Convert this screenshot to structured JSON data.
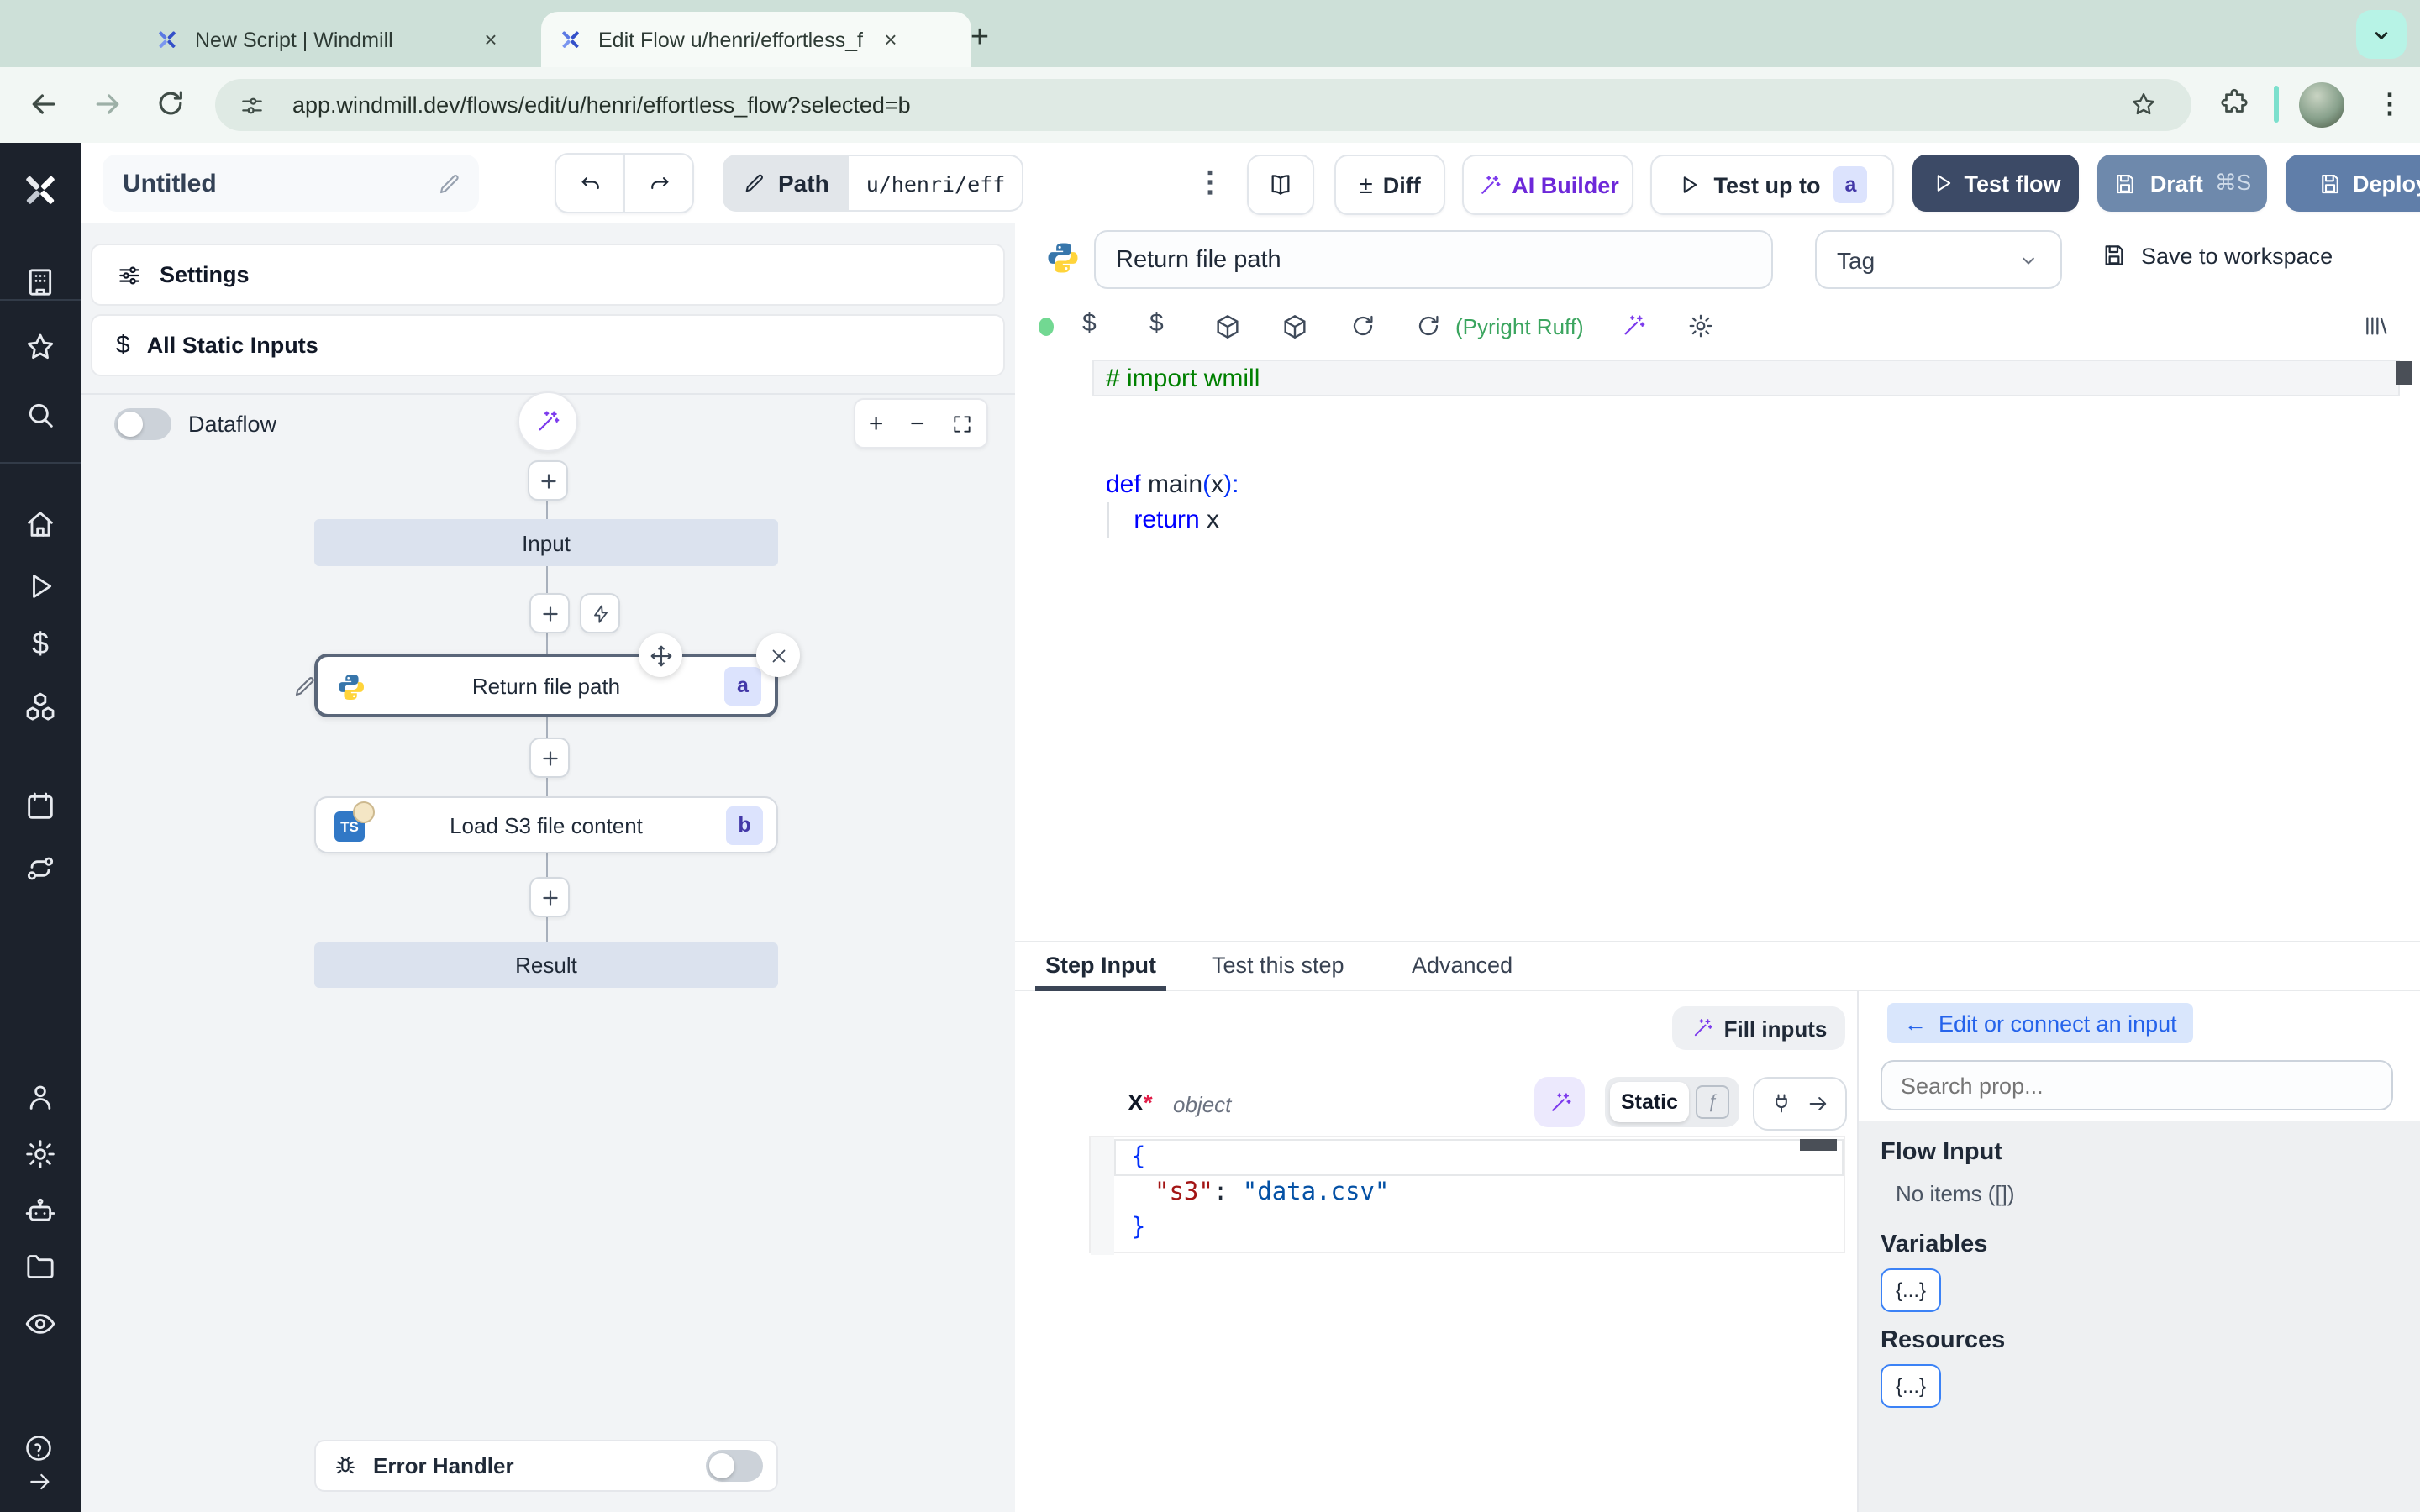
{
  "browser": {
    "tabs": [
      {
        "title": "New Script | Windmill"
      },
      {
        "title": "Edit Flow u/henri/effortless_fl"
      }
    ],
    "url": "app.windmill.dev/flows/edit/u/henri/effortless_flow?selected=b"
  },
  "icons": {
    "close": "×",
    "new_tab": "+",
    "kebab": "⋮",
    "plus_minus": "±",
    "dollar": "$",
    "plus": "+",
    "minus": "−",
    "back_arrow": "←",
    "fn": "ƒ",
    "asterisk": "*"
  },
  "sidebar_icons": [
    "windmill-logo",
    "workspace-building",
    "favorites-star",
    "search",
    "home",
    "runs-play",
    "variables-dollar",
    "resources-cubes",
    "schedules-calendar",
    "routes",
    "user",
    "settings-gear",
    "workers-robot",
    "folders",
    "audit-eye",
    "help",
    "collapse-arrow"
  ],
  "toolbar": {
    "flow_name": "Untitled",
    "path_label": "Path",
    "path_value": "u/henri/eff",
    "diff": "Diff",
    "ai_builder": "AI Builder",
    "test_up_to": "Test up to",
    "test_up_to_badge": "a",
    "test_flow": "Test flow",
    "draft": "Draft",
    "draft_shortcut": "⌘S",
    "deploy": "Deploy"
  },
  "flow_panel": {
    "settings": "Settings",
    "all_static_inputs": "All Static Inputs",
    "dataflow": "Dataflow",
    "nodes": {
      "input": "Input",
      "step_a": {
        "title": "Return file path",
        "badge": "a"
      },
      "step_b": {
        "title": "Load S3 file content",
        "badge": "b",
        "lang": "TS"
      },
      "result": "Result"
    },
    "error_handler": "Error Handler"
  },
  "step_editor": {
    "name": "Return file path",
    "tag_placeholder": "Tag",
    "save": "Save to workspace",
    "lint": "(Pyright Ruff)",
    "code": {
      "l1": "# import wmill",
      "def_kw": "def",
      "def_fn": " main",
      "par_open": "(",
      "arg": "x",
      "par_close": ")",
      "colon": ":",
      "indent": "    ",
      "ret_kw": "return",
      "ret_val": " x"
    }
  },
  "tabs": {
    "step_input": "Step Input",
    "test_this_step": "Test this step",
    "advanced": "Advanced"
  },
  "step_input": {
    "fill_inputs": "Fill inputs",
    "field": "X",
    "required": "*",
    "type": "object",
    "static": "Static",
    "json": {
      "open": "{",
      "key": "\"s3\"",
      "colon": ":",
      "value": " \"data.csv\"",
      "close": "}"
    }
  },
  "prop_panel": {
    "edit_connect": "Edit or connect an input",
    "search_placeholder": "Search prop...",
    "flow_input": "Flow Input",
    "no_items": "No items ([])",
    "variables": "Variables",
    "resources": "Resources",
    "braces": "{...}"
  },
  "colors": {
    "test_flow_bg": "#3c4a66",
    "draft_bg": "#6e89ac",
    "deploy_bg": "#607ea9",
    "ai_purple": "#6d28d9",
    "lint_green": "#3ba55f",
    "badge_bg": "#dce3fd",
    "badge_text": "#4338a8",
    "chrome_bg": "#cde0d8",
    "sidebar_bg": "#1c222c",
    "node_bg": "#dbe2ee",
    "connect_btn_bg": "#d9e6fc",
    "connect_btn_text": "#2563eb"
  }
}
